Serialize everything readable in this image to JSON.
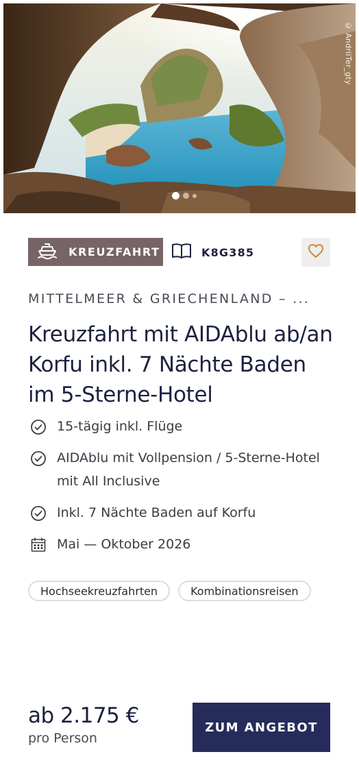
{
  "image": {
    "credit": "© AndriiTer_gty",
    "slides_total": 3,
    "active_slide": 1
  },
  "badges": {
    "type_label": "KREUZFAHRT",
    "type_icon": "ship-icon",
    "code_label": "K8G385",
    "code_icon": "book-icon",
    "favorite_icon": "heart-outline-icon"
  },
  "region": "MITTELMEER & GRIECHENLAND – ...",
  "title": "Kreuzfahrt mit AIDAblu ab/an Korfu inkl. 7 Nächte Baden im 5-Sterne-Hotel",
  "features": [
    {
      "icon": "check-circle-icon",
      "text": "15-tägig inkl. Flüge"
    },
    {
      "icon": "check-circle-icon",
      "text": "AIDAblu mit Vollpension / 5-Sterne-Ho­tel mit All Inclusive"
    },
    {
      "icon": "check-circle-icon",
      "text": "Inkl. 7 Nächte Baden auf Korfu"
    },
    {
      "icon": "calendar-icon",
      "text": "Mai — Oktober 2026"
    }
  ],
  "tags": [
    "Hochseekreuzfahrten",
    "Kombinationsreisen"
  ],
  "price": {
    "amount": "ab 2.175 €",
    "per": "pro Person"
  },
  "cta": {
    "label": "ZUM ANGEBOT"
  },
  "colors": {
    "accent": "#252c5b",
    "badge": "#776466",
    "heart": "#c78a3a",
    "text": "#1c2140"
  }
}
